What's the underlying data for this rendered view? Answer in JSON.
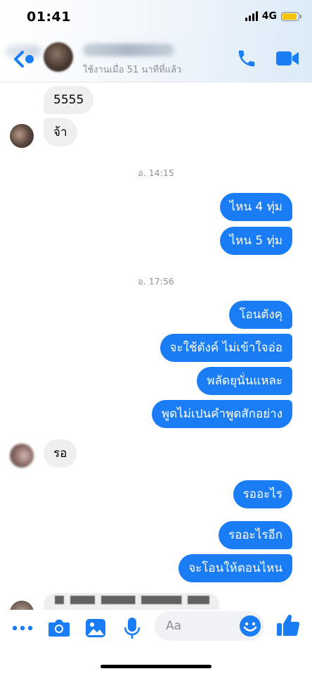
{
  "status_bar": {
    "time": "01:41",
    "network": "4G"
  },
  "header": {
    "last_seen": "ใช้งานเมื่อ 51 นาทีที่แล้ว"
  },
  "messages": {
    "m1": "5555",
    "m2": "จ้า",
    "ts1": "อ. 14:15",
    "m3": "ไหน 4 ทุ่ม",
    "m4": "ไหน 5 ทุ่ม",
    "ts2": "อ. 17:56",
    "m5": "โอนตังคุ",
    "m6": "จะใช้ตังค์ ไม่เข้าใจอ่อ",
    "m7": "พลัดยุนั่นแหละ",
    "m8": "พูดไม่เปนคำพูดสักอย่าง",
    "m9": "รอ",
    "m10": "รออะไร",
    "m11": "รออะไรอีก",
    "m12": "จะโอนให้ตอนไหน"
  },
  "composer": {
    "placeholder": "Aa"
  },
  "colors": {
    "accent": "#1a7df5",
    "incoming_bubble": "#eeeff1",
    "battery": "#f5c400"
  },
  "icons": [
    "back-chevron-icon",
    "phone-icon",
    "video-camera-icon",
    "more-icon",
    "camera-icon",
    "gallery-icon",
    "microphone-icon",
    "emoji-icon",
    "thumbs-up-icon"
  ]
}
